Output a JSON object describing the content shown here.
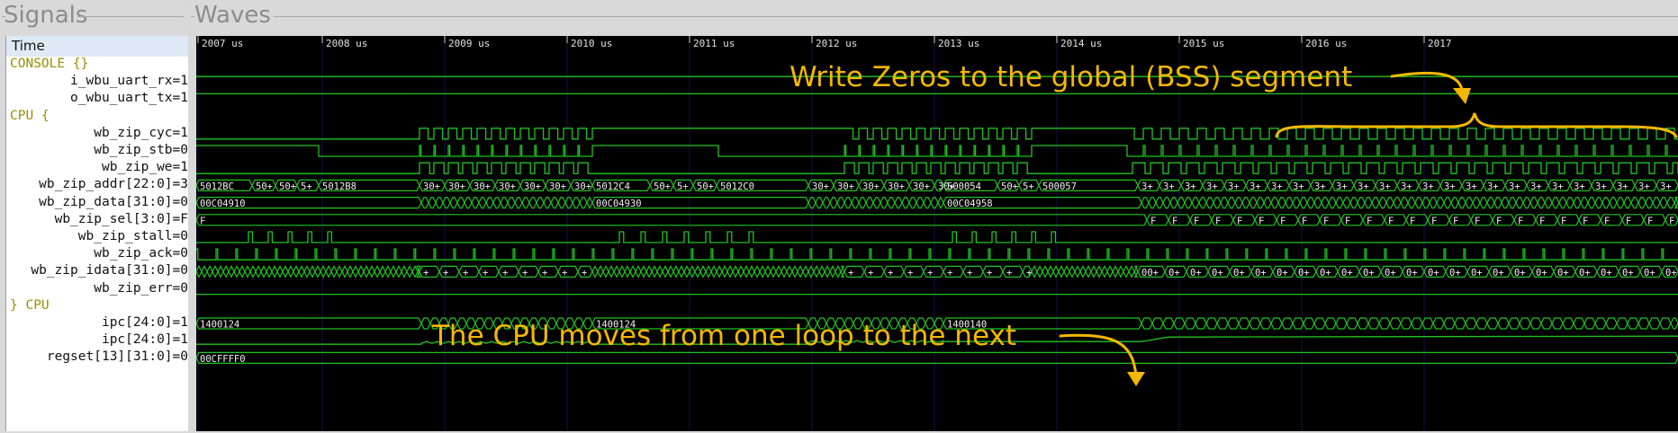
{
  "panels": {
    "signals_title": "Signals",
    "waves_title": "Waves"
  },
  "time_label": "Time",
  "signals": [
    {
      "label": "CONSOLE {}",
      "kind": "group"
    },
    {
      "label": "i_wbu_uart_rx=1",
      "kind": "sig"
    },
    {
      "label": "o_wbu_uart_tx=1",
      "kind": "sig"
    },
    {
      "label": "CPU {",
      "kind": "group"
    },
    {
      "label": "wb_zip_cyc=1",
      "kind": "sig"
    },
    {
      "label": "wb_zip_stb=0",
      "kind": "sig"
    },
    {
      "label": "wb_zip_we=1",
      "kind": "sig"
    },
    {
      "label": "wb_zip_addr[22:0]=3",
      "kind": "sig"
    },
    {
      "label": "wb_zip_data[31:0]=0",
      "kind": "sig"
    },
    {
      "label": "wb_zip_sel[3:0]=F",
      "kind": "sig"
    },
    {
      "label": "wb_zip_stall=0",
      "kind": "sig"
    },
    {
      "label": "wb_zip_ack=0",
      "kind": "sig"
    },
    {
      "label": "wb_zip_idata[31:0]=0",
      "kind": "sig"
    },
    {
      "label": "wb_zip_err=0",
      "kind": "sig"
    },
    {
      "label": "} CPU",
      "kind": "group"
    },
    {
      "label": "ipc[24:0]=1",
      "kind": "sig"
    },
    {
      "label": "ipc[24:0]=1",
      "kind": "sig"
    },
    {
      "label": "regset[13][31:0]=0",
      "kind": "sig"
    }
  ],
  "time_ticks": [
    "2007 us",
    "2008 us",
    "2009 us",
    "2010 us",
    "2011 us",
    "2012 us",
    "2013 us",
    "2014 us",
    "2015 us",
    "2016 us",
    "2017"
  ],
  "bus_values": {
    "addr": [
      "5012BC",
      "50+",
      "50+",
      "5+",
      "5012B8",
      "30+",
      "5012C4",
      "50+",
      "5+",
      "50+",
      "5012C0",
      "30+",
      "3+",
      "500054",
      "50+",
      "5+",
      "500057",
      "3+"
    ],
    "data": [
      "00C04910",
      "00C04930",
      "00C04958"
    ],
    "sel": [
      "F"
    ],
    "idata": [
      "00+",
      "0+",
      "+"
    ],
    "ipc": [
      "1400124",
      "1400124",
      "1400140",
      "+"
    ],
    "regset": [
      "00CFFFF0"
    ]
  },
  "annotations": {
    "bss": "Write Zeros to the global (BSS) segment",
    "loop": "The CPU moves from one loop to the next"
  },
  "colors": {
    "wave": "#21c421",
    "annotation": "#f5b800",
    "background": "#000000",
    "group_text": "#9a8e00"
  }
}
